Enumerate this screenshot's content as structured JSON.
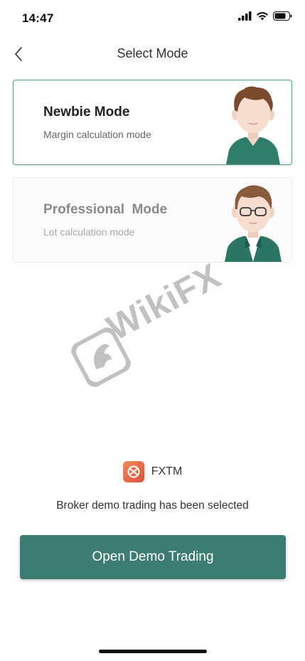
{
  "status_bar": {
    "time": "14:47",
    "icons": [
      "cellular-signal-icon",
      "wifi-icon",
      "battery-icon"
    ]
  },
  "nav": {
    "back_icon": "chevron-left-icon",
    "title": "Select Mode"
  },
  "modes": [
    {
      "title": "Newbie Mode",
      "subtitle": "Margin calculation mode",
      "selected": true
    },
    {
      "title": "Professional  Mode",
      "subtitle": "Lot calculation mode",
      "selected": false
    }
  ],
  "watermark": {
    "text": "WikiFX"
  },
  "broker": {
    "name": "FXTM",
    "logo_icon": "fxtm-logo-icon",
    "note": "Broker demo trading has been selected"
  },
  "action": {
    "label": "Open Demo Trading"
  },
  "colors": {
    "accent": "#3d7c72",
    "selected_border": "#5a9a8e",
    "broker_logo": "#e06a45"
  }
}
